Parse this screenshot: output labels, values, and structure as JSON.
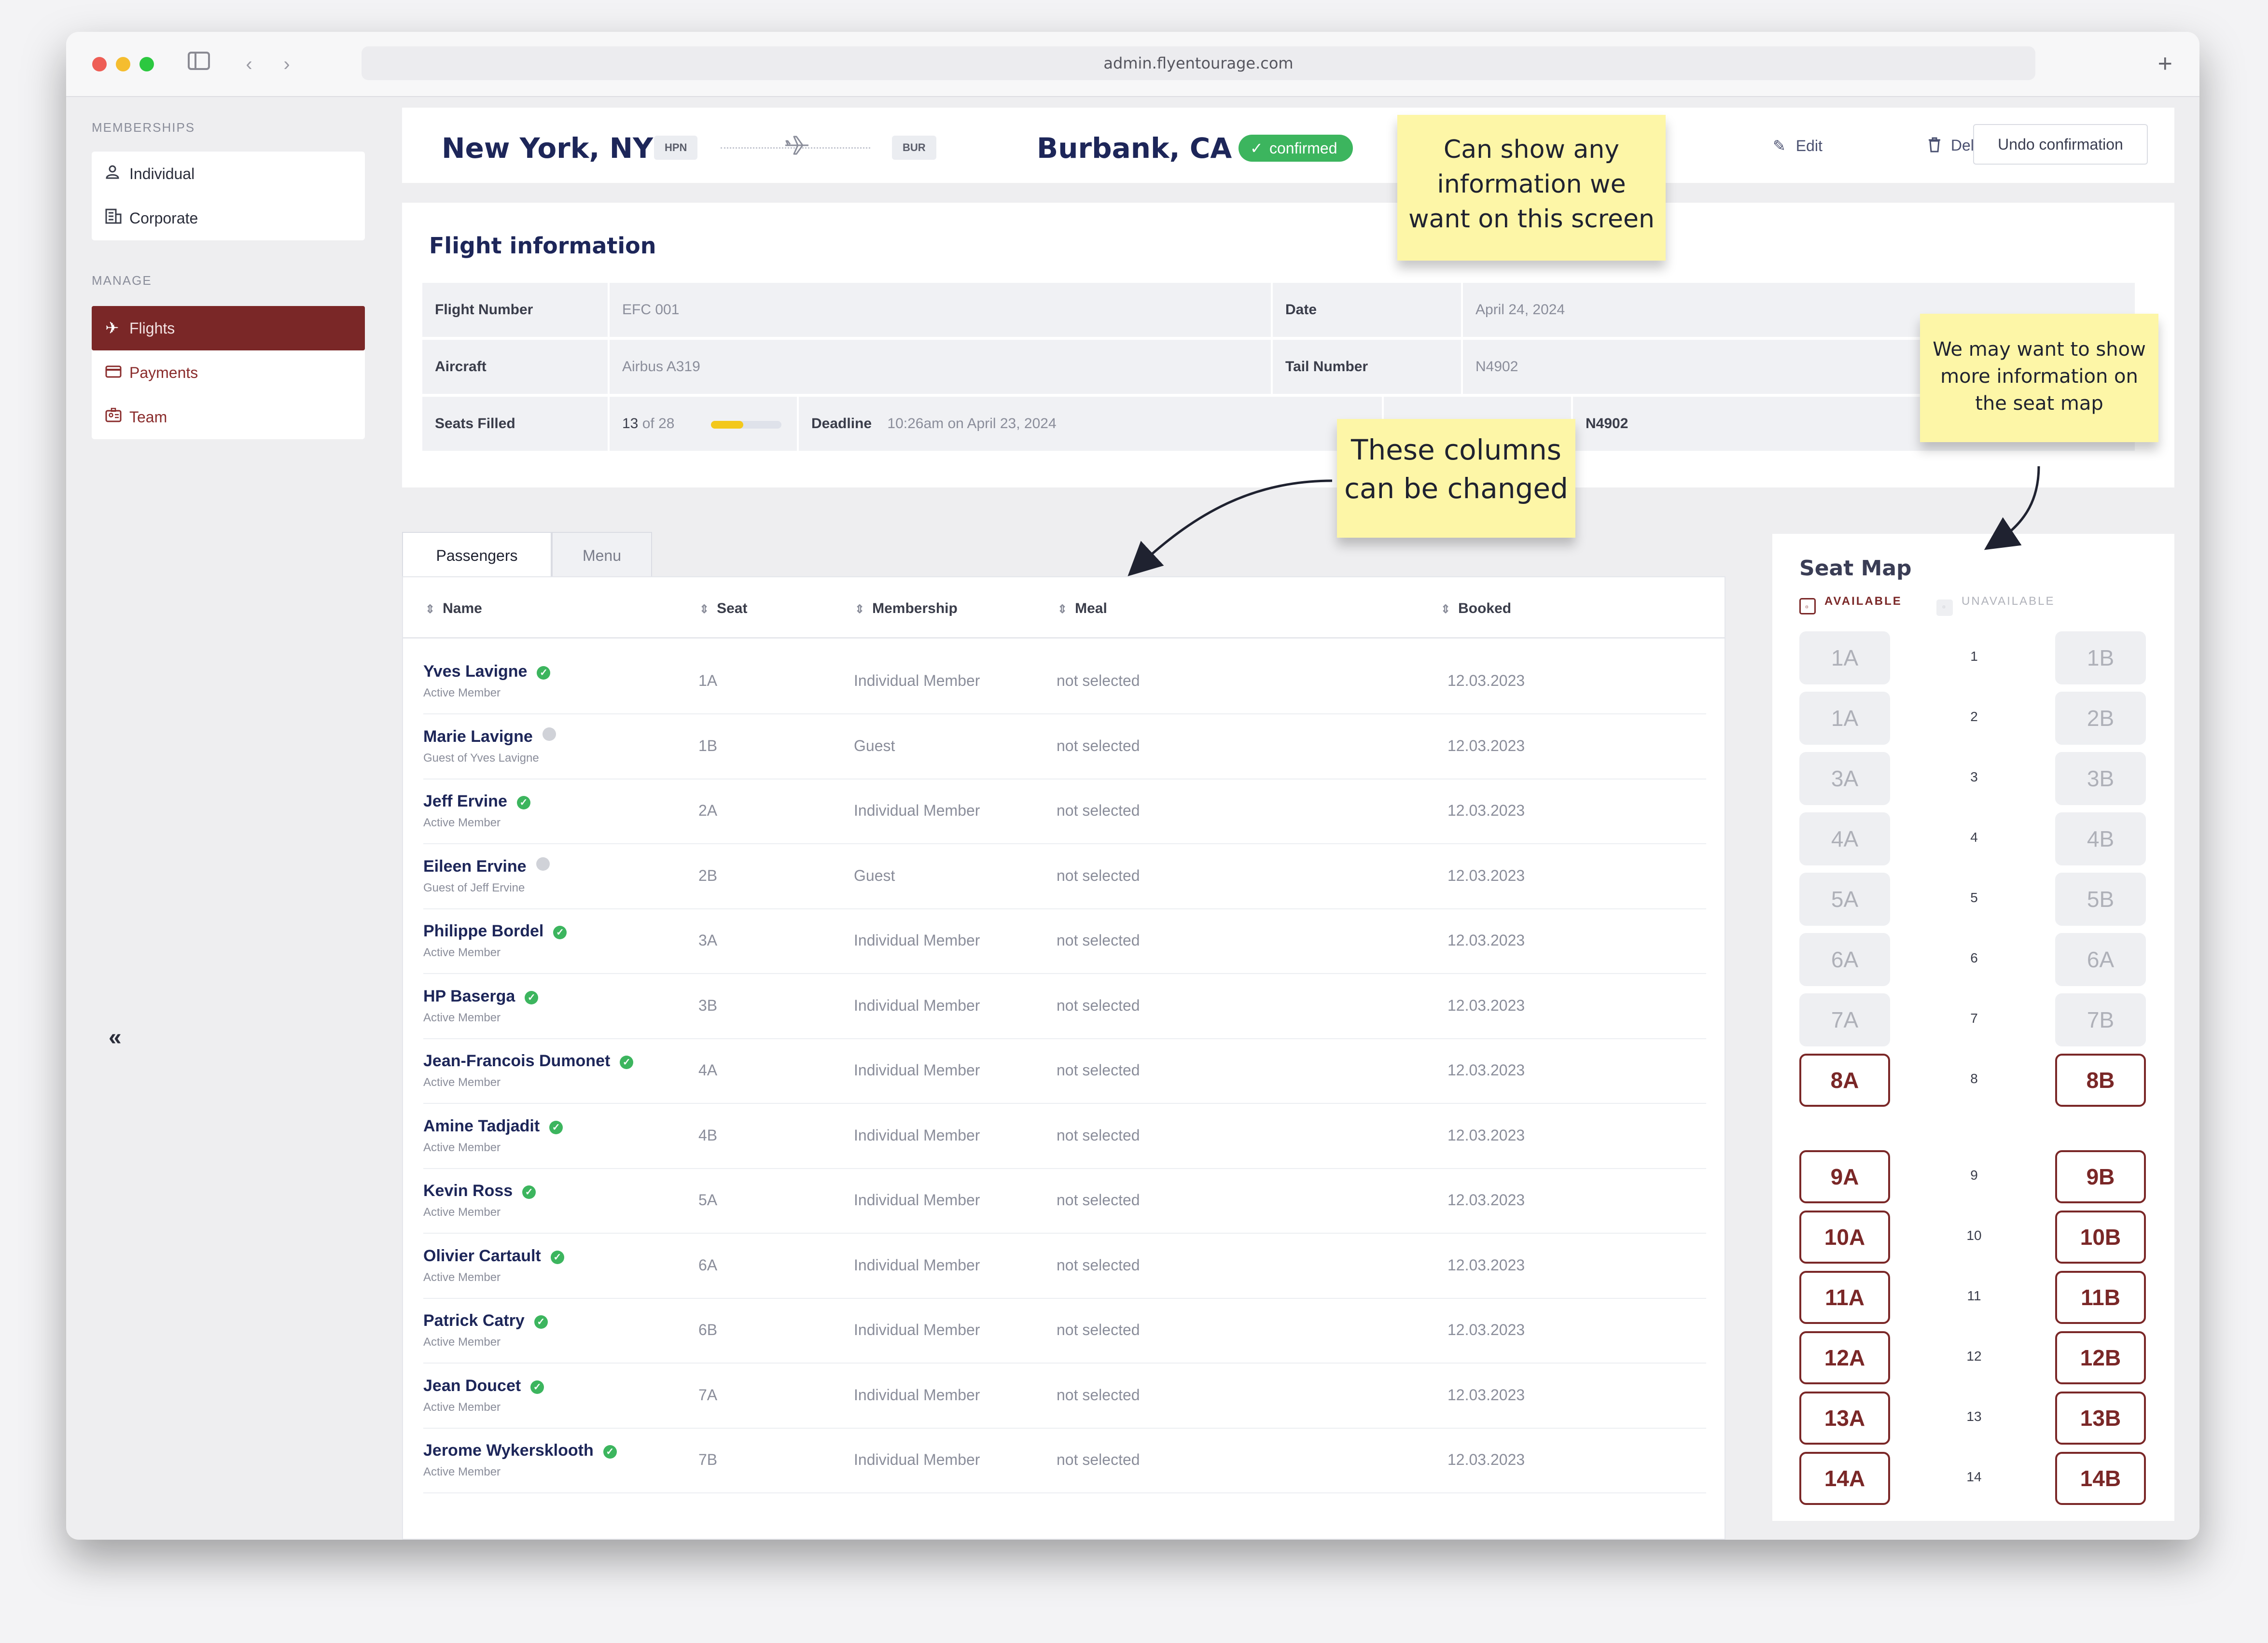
{
  "browser": {
    "url": "admin.flyentourage.com"
  },
  "sidebar": {
    "memberships_label": "MEMBERSHIPS",
    "memberships": [
      {
        "label": "Individual",
        "icon": "person-icon"
      },
      {
        "label": "Corporate",
        "icon": "building-icon"
      }
    ],
    "manage_label": "MANAGE",
    "manage": [
      {
        "label": "Flights",
        "icon": "plane-icon",
        "active": true
      },
      {
        "label": "Payments",
        "icon": "credit-card-icon"
      },
      {
        "label": "Team",
        "icon": "id-badge-icon"
      }
    ],
    "collapse_glyph": "«"
  },
  "header": {
    "origin_city": "New York, NY",
    "origin_code": "HPN",
    "dest_city": "Burbank, CA",
    "dest_code": "BUR",
    "status": "confirmed",
    "edit_label": "Edit",
    "delete_label": "Delete",
    "undo_label": "Undo confirmation"
  },
  "flight_info": {
    "title": "Flight information",
    "flight_number_label": "Flight Number",
    "flight_number": "EFC 001",
    "date_label": "Date",
    "date": "April 24, 2024",
    "aircraft_label": "Aircraft",
    "aircraft": "Airbus A319",
    "tail_label": "Tail Number",
    "tail": "N4902",
    "seats_label": "Seats Filled",
    "seats_filled": "13",
    "seats_of": "of 28",
    "seats_fraction": 0.46,
    "deadline_label": "Deadline",
    "deadline": "10:26am on April 23, 2024",
    "extra_value": "N4902"
  },
  "tabs": [
    "Passengers",
    "Menu"
  ],
  "columns": [
    "Name",
    "Seat",
    "Membership",
    "Meal",
    "Booked"
  ],
  "passengers": [
    {
      "name": "Yves Lavigne",
      "sub": "Active Member",
      "status": "active",
      "seat": "1A",
      "membership": "Individual Member",
      "meal": "not selected",
      "booked": "12.03.2023"
    },
    {
      "name": "Marie Lavigne",
      "sub": "Guest of Yves Lavigne",
      "status": "guest",
      "seat": "1B",
      "membership": "Guest",
      "meal": "not selected",
      "booked": "12.03.2023"
    },
    {
      "name": "Jeff Ervine",
      "sub": "Active Member",
      "status": "active",
      "seat": "2A",
      "membership": "Individual Member",
      "meal": "not selected",
      "booked": "12.03.2023"
    },
    {
      "name": "Eileen Ervine",
      "sub": "Guest of Jeff Ervine",
      "status": "guest",
      "seat": "2B",
      "membership": "Guest",
      "meal": "not selected",
      "booked": "12.03.2023"
    },
    {
      "name": "Philippe Bordel",
      "sub": "Active Member",
      "status": "active",
      "seat": "3A",
      "membership": "Individual Member",
      "meal": "not selected",
      "booked": "12.03.2023"
    },
    {
      "name": "HP Baserga",
      "sub": "Active Member",
      "status": "active",
      "seat": "3B",
      "membership": "Individual Member",
      "meal": "not selected",
      "booked": "12.03.2023"
    },
    {
      "name": "Jean-Francois Dumonet",
      "sub": "Active Member",
      "status": "active",
      "seat": "4A",
      "membership": "Individual Member",
      "meal": "not selected",
      "booked": "12.03.2023"
    },
    {
      "name": "Amine Tadjadit",
      "sub": "Active Member",
      "status": "active",
      "seat": "4B",
      "membership": "Individual Member",
      "meal": "not selected",
      "booked": "12.03.2023"
    },
    {
      "name": "Kevin Ross",
      "sub": "Active Member",
      "status": "active",
      "seat": "5A",
      "membership": "Individual Member",
      "meal": "not selected",
      "booked": "12.03.2023"
    },
    {
      "name": "Olivier Cartault",
      "sub": "Active Member",
      "status": "active",
      "seat": "6A",
      "membership": "Individual Member",
      "meal": "not selected",
      "booked": "12.03.2023"
    },
    {
      "name": "Patrick Catry",
      "sub": "Active Member",
      "status": "active",
      "seat": "6B",
      "membership": "Individual Member",
      "meal": "not selected",
      "booked": "12.03.2023"
    },
    {
      "name": "Jean Doucet",
      "sub": "Active Member",
      "status": "active",
      "seat": "7A",
      "membership": "Individual Member",
      "meal": "not selected",
      "booked": "12.03.2023"
    },
    {
      "name": "Jerome Wykersklooth",
      "sub": "Active Member",
      "status": "active",
      "seat": "7B",
      "membership": "Individual Member",
      "meal": "not selected",
      "booked": "12.03.2023"
    }
  ],
  "seat_map": {
    "title": "Seat Map",
    "legend_available": "AVAILABLE",
    "legend_unavailable": "UNAVAILABLE",
    "rows": [
      {
        "num": "1",
        "left": "1A",
        "right": "1B",
        "available": false
      },
      {
        "num": "2",
        "left": "1A",
        "right": "2B",
        "available": false
      },
      {
        "num": "3",
        "left": "3A",
        "right": "3B",
        "available": false
      },
      {
        "num": "4",
        "left": "4A",
        "right": "4B",
        "available": false
      },
      {
        "num": "5",
        "left": "5A",
        "right": "5B",
        "available": false
      },
      {
        "num": "6",
        "left": "6A",
        "right": "6A",
        "available": false
      },
      {
        "num": "7",
        "left": "7A",
        "right": "7B",
        "available": false
      },
      {
        "num": "8",
        "left": "8A",
        "right": "8B",
        "available": true
      },
      {
        "num": "9",
        "left": "9A",
        "right": "9B",
        "available": true
      },
      {
        "num": "10",
        "left": "10A",
        "right": "10B",
        "available": true
      },
      {
        "num": "11",
        "left": "11A",
        "right": "11B",
        "available": true
      },
      {
        "num": "12",
        "left": "12A",
        "right": "12B",
        "available": true
      },
      {
        "num": "13",
        "left": "13A",
        "right": "13B",
        "available": true
      },
      {
        "num": "14",
        "left": "14A",
        "right": "14B",
        "available": true
      }
    ]
  },
  "notes": {
    "screen_info": [
      "Can show any",
      "information we",
      "want on this screen"
    ],
    "columns": [
      "These columns",
      "can be changed"
    ],
    "seat_map": [
      "We may want to show",
      "more information on",
      "the seat map"
    ]
  },
  "colors": {
    "brand": "#7a2727",
    "navy": "#1d2659",
    "confirmed": "#3cb55e",
    "sticky": "#fdf6a7"
  }
}
